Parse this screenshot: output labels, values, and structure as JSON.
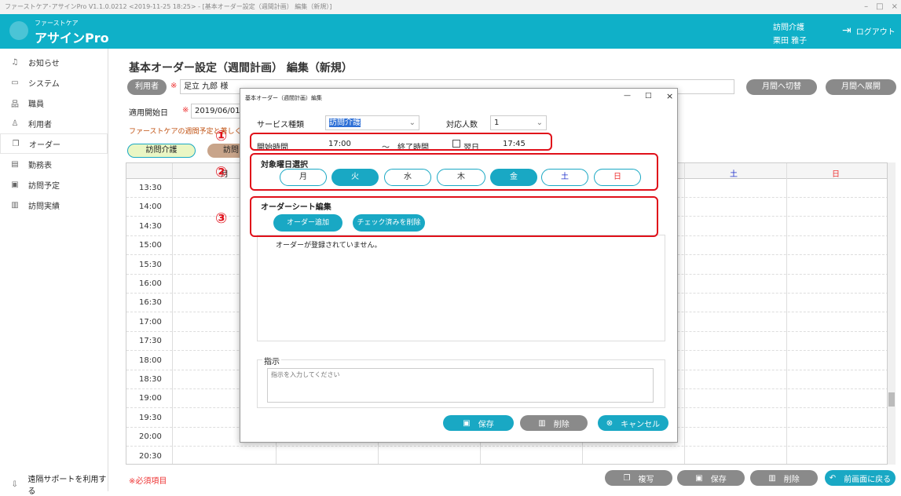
{
  "window": {
    "title": "ファーストケア･アサインPro V1.1.0.0212 <2019-11-25 18:25> - [基本オーダー設定（週間計画） 編集（新規）]",
    "minimize": "–",
    "restore": "□",
    "close": "×"
  },
  "header": {
    "logo_sub": "ファーストケア",
    "logo_name": "アサインPro",
    "service": "訪問介護",
    "user": "栗田 雅子",
    "logout": "ログアウト"
  },
  "sidebar": {
    "items": [
      {
        "label": "お知らせ",
        "icon": "bell-icon"
      },
      {
        "label": "システム",
        "icon": "monitor-icon"
      },
      {
        "label": "職員",
        "icon": "staff-icon"
      },
      {
        "label": "利用者",
        "icon": "user-icon"
      },
      {
        "label": "オーダー",
        "icon": "copy-icon"
      },
      {
        "label": "勤務表",
        "icon": "schedule-icon"
      },
      {
        "label": "訪問予定",
        "icon": "calendar-icon"
      },
      {
        "label": "訪問実績",
        "icon": "report-icon"
      }
    ],
    "remote": "遠隔サポートを利用する"
  },
  "main": {
    "title": "基本オーダー設定（週間計画） 編集（新規）",
    "user_btn": "利用者",
    "required_mark": "※",
    "user_value": "足立 九郎 様",
    "start_label": "適用開始日",
    "start_date": "2019/06/01",
    "note": "ファーストケアの週間予定と著しく時間",
    "service_tab": "訪問介護",
    "monthly_switch": "月間へ切替",
    "monthly_expand": "月間へ展開",
    "required_note": "※必須項目",
    "day_sat": "土",
    "day_sun": "日",
    "day_mon_partial": "月",
    "service_tab2_partial": "訪問",
    "times": [
      "13:30",
      "14:00",
      "14:30",
      "15:00",
      "15:30",
      "16:00",
      "16:30",
      "17:00",
      "17:30",
      "18:00",
      "18:30",
      "19:00",
      "19:30",
      "20:00",
      "20:30"
    ],
    "bottom": {
      "copy": "複写",
      "save": "保存",
      "delete": "削除",
      "back": "前画面に戻る"
    }
  },
  "modal": {
    "title": "基本オーダー（週間計画）編集",
    "minimize": "—",
    "maximize": "□",
    "close": "×",
    "service_label": "サービス種類",
    "service_value": "訪問介護",
    "count_label": "対応人数",
    "count_value": "1",
    "start_time_label": "開始時間",
    "start_time": "17:00",
    "tilde": "～",
    "end_time_label": "終了時間",
    "nextday_label": "翌日",
    "end_time": "17:45",
    "day_select_label": "対象曜日選択",
    "days": [
      {
        "label": "月",
        "selected": false
      },
      {
        "label": "火",
        "selected": true
      },
      {
        "label": "水",
        "selected": false
      },
      {
        "label": "木",
        "selected": false
      },
      {
        "label": "金",
        "selected": true
      },
      {
        "label": "土",
        "selected": false
      },
      {
        "label": "日",
        "selected": false
      }
    ],
    "order_sheet_label": "オーダーシート編集",
    "add_order": "オーダー追加",
    "delete_checked": "チェック済みを削除",
    "no_order": "オーダーが登録されていません。",
    "instruction_label": "指示",
    "instruction_placeholder": "指示を入力してください",
    "save": "保存",
    "delete": "削除",
    "cancel": "キャンセル"
  },
  "annotations": [
    "①",
    "②",
    "③"
  ],
  "colors": {
    "accent": "#0fb0c8",
    "button": "#19a8c4",
    "gray": "#8a8a8a",
    "annotation": "#e0101a"
  }
}
